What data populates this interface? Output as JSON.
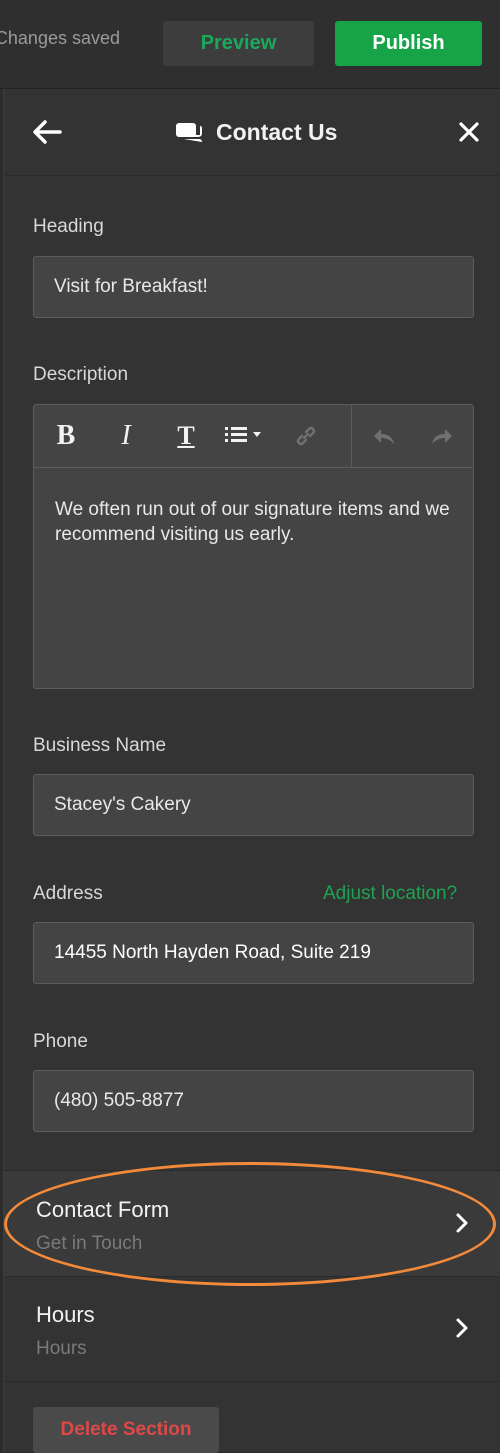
{
  "topbar": {
    "status_text": "Changes saved",
    "preview_label": "Preview",
    "publish_label": "Publish"
  },
  "panel": {
    "title": "Contact Us",
    "title_icon": "chat-bubbles-icon",
    "heading": {
      "label": "Heading",
      "value": "Visit for Breakfast!"
    },
    "description": {
      "label": "Description",
      "text": "We often run out of our signature items and we recommend visiting us early.",
      "toolbar_icons": [
        "bold-icon",
        "italic-icon",
        "text-format-icon",
        "list-dropdown-icon",
        "link-icon",
        "undo-icon",
        "redo-icon"
      ]
    },
    "business_name": {
      "label": "Business Name",
      "value": "Stacey's Cakery"
    },
    "address": {
      "label": "Address",
      "adjust_link": "Adjust location?",
      "value": "14455 North Hayden Road, Suite 219"
    },
    "phone": {
      "label": "Phone",
      "value": "(480) 505-8877"
    },
    "nav_items": [
      {
        "title": "Contact Form",
        "subtitle": "Get in Touch"
      },
      {
        "title": "Hours",
        "subtitle": "Hours"
      }
    ],
    "delete_label": "Delete Section"
  },
  "colors": {
    "accent_green": "#17a348",
    "delete_red": "#e04848",
    "highlight_orange": "#f3893a"
  }
}
